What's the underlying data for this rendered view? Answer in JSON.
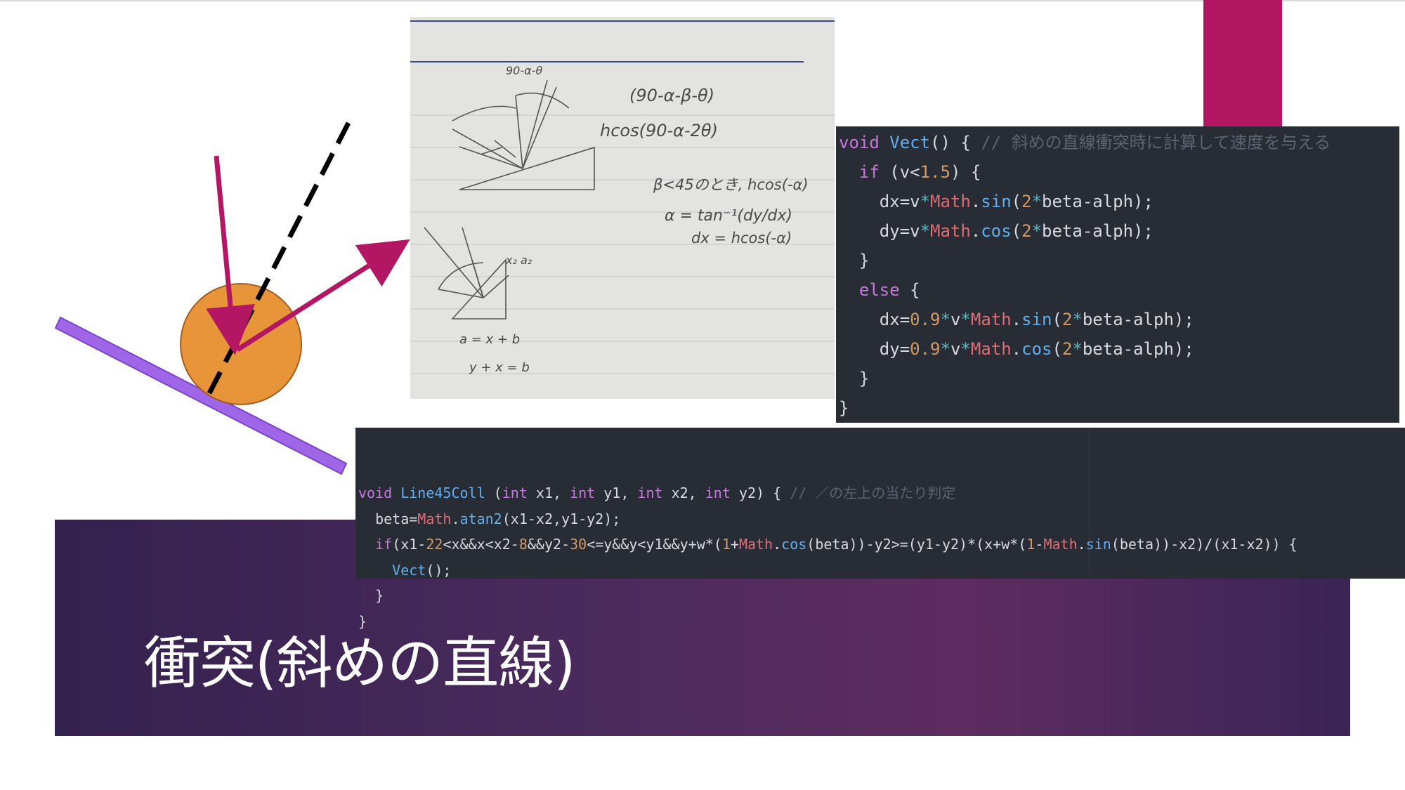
{
  "slide": {
    "title": "衝突(斜めの直線)",
    "accent_color": "#b31764",
    "band_color": "#4a2a5c"
  },
  "diagram": {
    "ball_color": "#e8953a",
    "slope_color": "#a066e8",
    "arrow_color": "#b31764",
    "normal_line": "dashed black"
  },
  "notebook": {
    "note_lines": [
      "(90-α-β-θ)",
      "hcos(90-α-2θ)",
      "β<45のとき, hcos(-α)",
      "α = tan⁻¹(dy/dx)",
      "dx = hcos(-α)",
      "90-α-θ",
      "x₂ a₂",
      "a = x + b",
      "y + x = b"
    ]
  },
  "code_vect": {
    "lines": [
      {
        "tokens": [
          [
            "kw",
            "void "
          ],
          [
            "fn",
            "Vect"
          ],
          [
            "txt",
            "() { "
          ],
          [
            "cm",
            "// 斜めの直線衝突時に計算して速度を与える"
          ]
        ]
      },
      {
        "tokens": [
          [
            "txt",
            "  "
          ],
          [
            "kw",
            "if"
          ],
          [
            "txt",
            " (v<"
          ],
          [
            "num",
            "1.5"
          ],
          [
            "txt",
            ") {"
          ]
        ]
      },
      {
        "tokens": [
          [
            "txt",
            "    dx=v"
          ],
          [
            "op",
            "*"
          ],
          [
            "cls",
            "Math"
          ],
          [
            "txt",
            "."
          ],
          [
            "fn",
            "sin"
          ],
          [
            "txt",
            "("
          ],
          [
            "num",
            "2"
          ],
          [
            "op",
            "*"
          ],
          [
            "txt",
            "beta-alph);"
          ]
        ]
      },
      {
        "tokens": [
          [
            "txt",
            "    dy=v"
          ],
          [
            "op",
            "*"
          ],
          [
            "cls",
            "Math"
          ],
          [
            "txt",
            "."
          ],
          [
            "fn",
            "cos"
          ],
          [
            "txt",
            "("
          ],
          [
            "num",
            "2"
          ],
          [
            "op",
            "*"
          ],
          [
            "txt",
            "beta-alph);"
          ]
        ]
      },
      {
        "tokens": [
          [
            "txt",
            "  }"
          ]
        ]
      },
      {
        "tokens": [
          [
            "txt",
            "  "
          ],
          [
            "kw",
            "else"
          ],
          [
            "txt",
            " {"
          ]
        ]
      },
      {
        "tokens": [
          [
            "txt",
            "    dx="
          ],
          [
            "num",
            "0.9"
          ],
          [
            "op",
            "*"
          ],
          [
            "txt",
            "v"
          ],
          [
            "op",
            "*"
          ],
          [
            "cls",
            "Math"
          ],
          [
            "txt",
            "."
          ],
          [
            "fn",
            "sin"
          ],
          [
            "txt",
            "("
          ],
          [
            "num",
            "2"
          ],
          [
            "op",
            "*"
          ],
          [
            "txt",
            "beta-alph);"
          ]
        ]
      },
      {
        "tokens": [
          [
            "txt",
            "    dy="
          ],
          [
            "num",
            "0.9"
          ],
          [
            "op",
            "*"
          ],
          [
            "txt",
            "v"
          ],
          [
            "op",
            "*"
          ],
          [
            "cls",
            "Math"
          ],
          [
            "txt",
            "."
          ],
          [
            "fn",
            "cos"
          ],
          [
            "txt",
            "("
          ],
          [
            "num",
            "2"
          ],
          [
            "op",
            "*"
          ],
          [
            "txt",
            "beta-alph);"
          ]
        ]
      },
      {
        "tokens": [
          [
            "txt",
            "  }"
          ]
        ]
      },
      {
        "tokens": [
          [
            "txt",
            "}"
          ]
        ]
      }
    ]
  },
  "code_line45": {
    "lines": [
      {
        "tokens": [
          [
            "kw",
            "void "
          ],
          [
            "fn",
            "Line45Coll"
          ],
          [
            "txt",
            " ("
          ],
          [
            "kw",
            "int"
          ],
          [
            "txt",
            " x1, "
          ],
          [
            "kw",
            "int"
          ],
          [
            "txt",
            " y1, "
          ],
          [
            "kw",
            "int"
          ],
          [
            "txt",
            " x2, "
          ],
          [
            "kw",
            "int"
          ],
          [
            "txt",
            " y2) { "
          ],
          [
            "cm",
            "// ／の左上の当たり判定"
          ]
        ]
      },
      {
        "tokens": [
          [
            "txt",
            "  beta="
          ],
          [
            "cls",
            "Math"
          ],
          [
            "txt",
            "."
          ],
          [
            "fn",
            "atan2"
          ],
          [
            "txt",
            "(x1-x2,y1-y2);"
          ]
        ]
      },
      {
        "tokens": [
          [
            "txt",
            "  "
          ],
          [
            "kw",
            "if"
          ],
          [
            "txt",
            "(x1-"
          ],
          [
            "num",
            "22"
          ],
          [
            "txt",
            "<x&&x<x2-"
          ],
          [
            "num",
            "8"
          ],
          [
            "txt",
            "&&y2-"
          ],
          [
            "num",
            "30"
          ],
          [
            "txt",
            "<=y&&y<y1&&y+w*("
          ],
          [
            "num",
            "1"
          ],
          [
            "txt",
            "+"
          ],
          [
            "cls",
            "Math"
          ],
          [
            "txt",
            "."
          ],
          [
            "fn",
            "cos"
          ],
          [
            "txt",
            "(beta))-y2>=(y1-y2)*(x+w*("
          ],
          [
            "num",
            "1"
          ],
          [
            "txt",
            "-"
          ],
          [
            "cls",
            "Math"
          ],
          [
            "txt",
            "."
          ],
          [
            "fn",
            "sin"
          ],
          [
            "txt",
            "(beta))-x2)/(x1-x2)) {"
          ]
        ]
      },
      {
        "tokens": [
          [
            "txt",
            "    "
          ],
          [
            "fn",
            "Vect"
          ],
          [
            "txt",
            "();"
          ]
        ]
      },
      {
        "tokens": [
          [
            "txt",
            "  }"
          ]
        ]
      },
      {
        "tokens": [
          [
            "txt",
            "}"
          ]
        ]
      }
    ]
  }
}
